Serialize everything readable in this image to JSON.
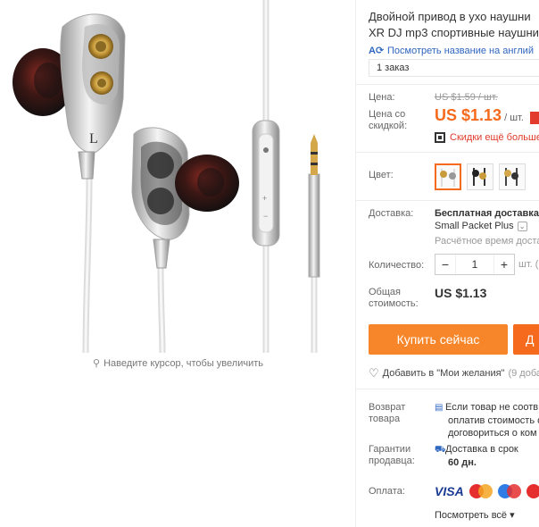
{
  "gallery": {
    "zoom_hint": "Наведите курсор, чтобы увеличить",
    "zoom_icon": "search-icon"
  },
  "product": {
    "title_line1": "Двойной привод в ухо наушни",
    "title_line2": "XR DJ mp3 спортивные наушни",
    "translate_link": "Посмотреть название на англий",
    "orders": "1 заказ"
  },
  "price": {
    "label": "Цена:",
    "old": "US $1.59 / шт.",
    "discount_label_1": "Цена со",
    "discount_label_2": "скидкой:",
    "new": "US $1.13",
    "unit": "/ шт.",
    "coupon": "Скидки ещё больше"
  },
  "color": {
    "label": "Цвет:"
  },
  "shipping": {
    "label": "Доставка:",
    "main": "Бесплатная доставка в",
    "method": "Small Packet Plus",
    "estimate": "Расчётное время доста"
  },
  "quantity": {
    "label": "Количество:",
    "minus": "−",
    "value": "1",
    "plus": "+",
    "unit": "шт. (",
    "total_label_1": "Общая",
    "total_label_2": "стоимость:",
    "total": "US $1.13"
  },
  "actions": {
    "buy_now": "Купить сейчас",
    "add_to_cart": "Д",
    "wishlist": "Добавить в \"Мои желания\"",
    "wishlist_count": "(9 доба"
  },
  "returns": {
    "label_1": "Возврат",
    "label_2": "товара",
    "line1": "Если товар не соотв",
    "line2": "оплатив стоимость о",
    "line3": "договориться о ком"
  },
  "guarantee": {
    "label_1": "Гарантии",
    "label_2": "продавца:",
    "line1": "Доставка в срок",
    "line2": "60 дн."
  },
  "payment": {
    "label": "Оплата:",
    "visa": "VISA",
    "more": "Посмотреть всё ▾"
  },
  "colors": {
    "accent": "#f56a1c",
    "buy_button": "#f7862a",
    "link": "#2f66c0",
    "coupon": "#e03a2a"
  }
}
